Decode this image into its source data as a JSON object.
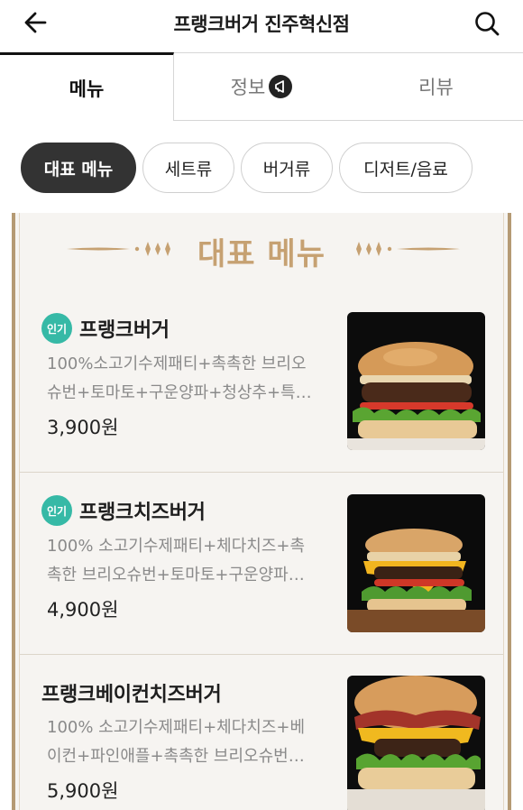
{
  "header": {
    "title": "프랭크버거 진주혁신점",
    "back_icon": "back-arrow-icon",
    "search_icon": "search-icon"
  },
  "tabs": [
    {
      "label": "메뉴",
      "active": true
    },
    {
      "label": "정보",
      "active": false,
      "icon": "megaphone-icon"
    },
    {
      "label": "리뷰",
      "active": false
    }
  ],
  "chips": [
    {
      "label": "대표 메뉴",
      "active": true
    },
    {
      "label": "세트류",
      "active": false
    },
    {
      "label": "버거류",
      "active": false
    },
    {
      "label": "디저트/음료",
      "active": false
    }
  ],
  "section": {
    "title": "대표 메뉴",
    "accent_color": "#c6a172"
  },
  "items": [
    {
      "badge": "인기",
      "name": "프랭크버거",
      "desc_line1": "100%소고기수제패티+촉촉한 브리오",
      "desc_line2": "슈번+토마토+구운양파+청상추+특…",
      "price": "3,900원"
    },
    {
      "badge": "인기",
      "name": "프랭크치즈버거",
      "desc_line1": "100% 소고기수제패티+체다치즈+촉",
      "desc_line2": "촉한 브리오슈번+토마토+구운양파…",
      "price": "4,900원"
    },
    {
      "badge": "",
      "name": "프랭크베이컨치즈버거",
      "desc_line1": "100% 소고기수제패티+체다치즈+베",
      "desc_line2": "이컨+파인애플+촉촉한 브리오슈번…",
      "price": "5,900원"
    }
  ],
  "colors": {
    "popular_badge": "#36b9a6",
    "frame": "#b59a74"
  }
}
